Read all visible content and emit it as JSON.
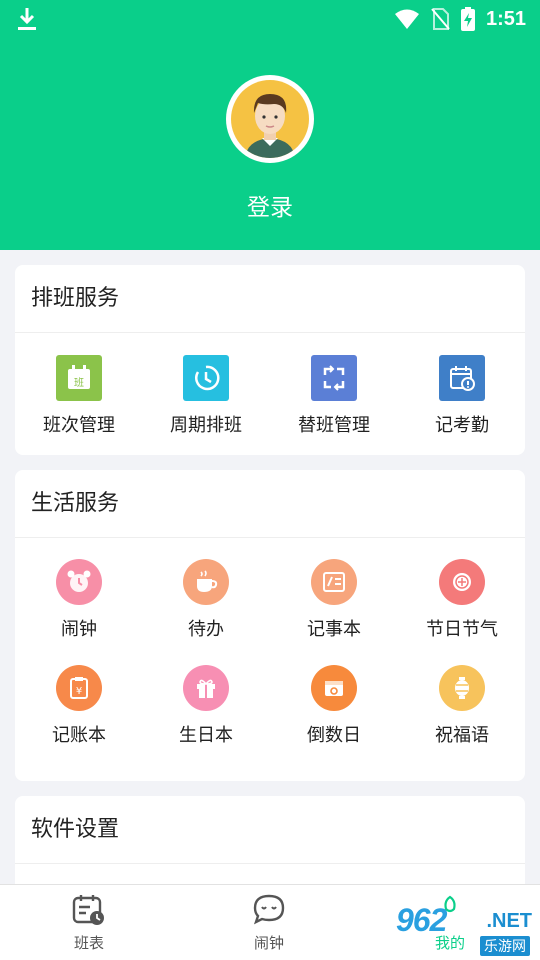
{
  "status_bar": {
    "time": "1:51"
  },
  "profile": {
    "login_label": "登录"
  },
  "sections": [
    {
      "title": "排班服务",
      "items": [
        {
          "label": "班次管理",
          "icon": "calendar-shift-icon",
          "color": "#8bc34a"
        },
        {
          "label": "周期排班",
          "icon": "clock-cycle-icon",
          "color": "#26bfe0"
        },
        {
          "label": "替班管理",
          "icon": "swap-icon",
          "color": "#5b7fd6"
        },
        {
          "label": "记考勤",
          "icon": "attendance-icon",
          "color": "#3f7fc8"
        }
      ]
    },
    {
      "title": "生活服务",
      "items": [
        {
          "label": "闹钟",
          "icon": "alarm-icon",
          "color": "#f78fa7"
        },
        {
          "label": "待办",
          "icon": "coffee-cup-icon",
          "color": "#f7a57c"
        },
        {
          "label": "记事本",
          "icon": "notebook-icon",
          "color": "#f7a57c"
        },
        {
          "label": "节日节气",
          "icon": "lantern-festival-icon",
          "color": "#f47a7a"
        },
        {
          "label": "记账本",
          "icon": "ledger-icon",
          "color": "#f7894a"
        },
        {
          "label": "生日本",
          "icon": "gift-icon",
          "color": "#f78fb3"
        },
        {
          "label": "倒数日",
          "icon": "countdown-icon",
          "color": "#f78a3c"
        },
        {
          "label": "祝福语",
          "icon": "lantern-icon",
          "color": "#f7c35c"
        }
      ]
    },
    {
      "title": "软件设置",
      "items": []
    }
  ],
  "tabbar": {
    "items": [
      {
        "label": "班表",
        "icon": "schedule-tab-icon"
      },
      {
        "label": "闹钟",
        "icon": "alarm-chat-tab-icon"
      },
      {
        "label": "我的",
        "icon": "profile-tab-icon"
      }
    ]
  },
  "watermark": {
    "text": "962",
    "suffix": ".NET",
    "sub": "乐游网"
  },
  "colors": {
    "header": "#0acf8a",
    "background": "#f2f3f7"
  }
}
